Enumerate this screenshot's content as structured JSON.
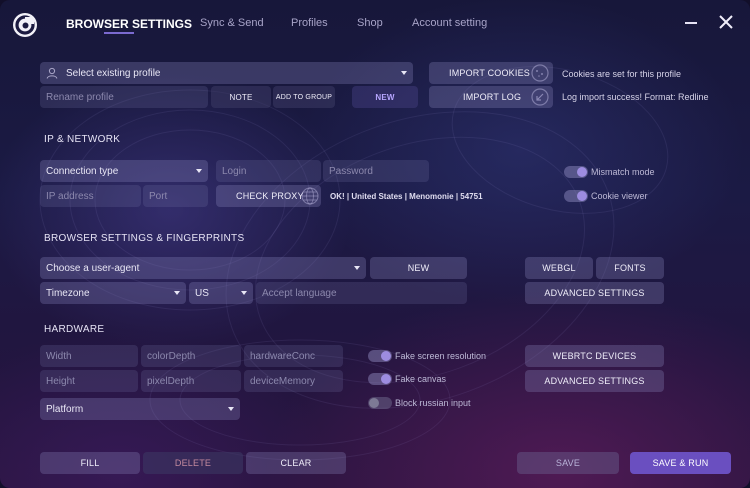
{
  "nav": {
    "items": [
      {
        "label": "BROWSER SETTINGS",
        "active": true
      },
      {
        "label": "Sync & Send"
      },
      {
        "label": "Profiles"
      },
      {
        "label": "Shop"
      },
      {
        "label": "Account setting"
      }
    ]
  },
  "profile": {
    "select_placeholder": "Select existing profile",
    "rename_placeholder": "Rename profile",
    "note_label": "NOTE",
    "add_to_group_label": "ADD TO GROUP",
    "new_label": "NEW"
  },
  "import": {
    "cookies_label": "IMPORT COOKIES",
    "cookies_status": "Cookies are set for this profile",
    "log_label": "IMPORT LOG",
    "log_status": "Log import success! Format: Redline"
  },
  "network": {
    "title": "IP & NETWORK",
    "connection_type": "Connection type",
    "login_placeholder": "Login",
    "password_placeholder": "Password",
    "ip_placeholder": "IP address",
    "port_placeholder": "Port",
    "check_proxy_label": "CHECK PROXY",
    "proxy_status": "OK!   |   United States   |   Menomonie   |   54751",
    "mismatch_label": "Mismatch mode",
    "cookie_viewer_label": "Cookie viewer"
  },
  "fingerprints": {
    "title": "BROWSER SETTINGS & FINGERPRINTS",
    "user_agent": "Choose a user-agent",
    "new_label": "NEW",
    "timezone": "Timezone",
    "country": "US",
    "accept_language_placeholder": "Accept language",
    "webgl_label": "WEBGL",
    "fonts_label": "FONTS",
    "advanced_label": "ADVANCED SETTINGS"
  },
  "hardware": {
    "title": "HARDWARE",
    "width_placeholder": "Width",
    "color_depth_placeholder": "colorDepth",
    "hardware_conc_placeholder": "hardwareConc",
    "height_placeholder": "Height",
    "pixel_depth_placeholder": "pixelDepth",
    "device_memory_placeholder": "deviceMemory",
    "platform": "Platform",
    "fake_screen_label": "Fake screen resolution",
    "fake_canvas_label": "Fake canvas",
    "block_russian_label": "Block russian input",
    "webrtc_label": "WEBRTC DEVICES",
    "advanced_label": "ADVANCED SETTINGS"
  },
  "footer": {
    "fill_label": "FILL",
    "delete_label": "DELETE",
    "clear_label": "CLEAR",
    "save_label": "SAVE",
    "save_run_label": "SAVE & RUN"
  },
  "colors": {
    "accent": "#6a4fc0",
    "delete_text": "#c48a9e"
  },
  "icons": [
    "app-logo-icon",
    "minimize-icon",
    "close-icon",
    "user-icon",
    "cookie-icon",
    "log-icon",
    "globe-icon"
  ]
}
